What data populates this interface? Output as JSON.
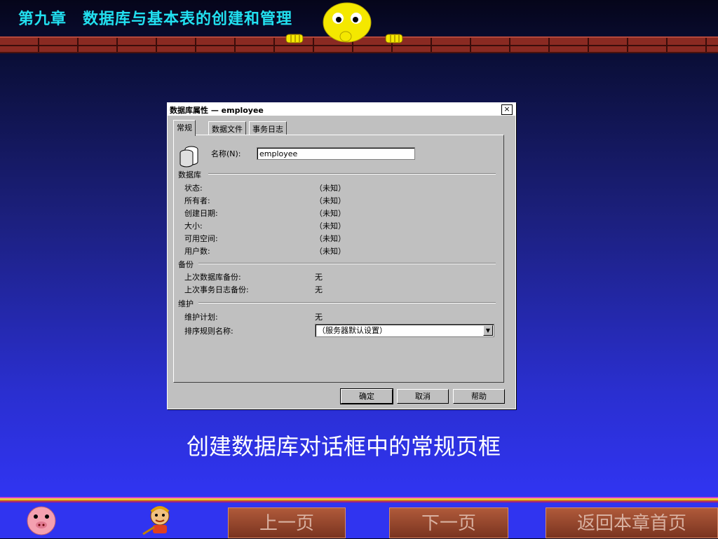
{
  "slide": {
    "title": "第九章　数据库与基本表的创建和管理",
    "caption": "创建数据库对话框中的常规页框",
    "nav": {
      "prev": "上一页",
      "next": "下一页",
      "home": "返回本章首页"
    }
  },
  "dialog": {
    "title": "数据库属性 — employee",
    "close": "×",
    "tabs": [
      "常规",
      "数据文件",
      "事务日志"
    ],
    "name_label": "名称(N):",
    "name_value": "employee",
    "sections": {
      "database": {
        "label": "数据库",
        "rows": [
          {
            "label": "状态:",
            "value": "（未知）"
          },
          {
            "label": "所有者:",
            "value": "（未知）"
          },
          {
            "label": "创建日期:",
            "value": "（未知）"
          },
          {
            "label": "大小:",
            "value": "（未知）"
          },
          {
            "label": "可用空间:",
            "value": "（未知）"
          },
          {
            "label": "用户数:",
            "value": "（未知）"
          }
        ]
      },
      "backup": {
        "label": "备份",
        "rows": [
          {
            "label": "上次数据库备份:",
            "value": "无"
          },
          {
            "label": "上次事务日志备份:",
            "value": "无"
          }
        ]
      },
      "maintenance": {
        "label": "维护",
        "rows": [
          {
            "label": "维护计划:",
            "value": "无"
          },
          {
            "label": "排序规则名称:",
            "value": "（服务器默认设置）"
          }
        ]
      }
    },
    "buttons": {
      "ok": "确定",
      "cancel": "取消",
      "help": "帮助"
    }
  },
  "colors": {
    "title": "#22e0f0",
    "background_top": "#05051a",
    "background_bottom": "#3034f0",
    "dialog": "#c0c0c0"
  }
}
